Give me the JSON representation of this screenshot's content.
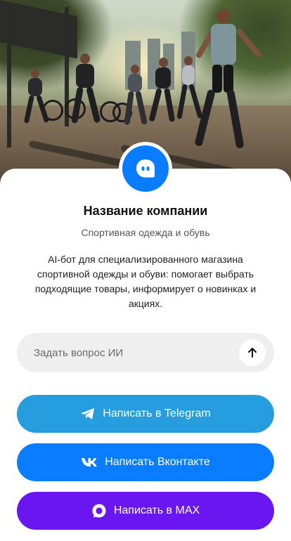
{
  "company": {
    "name": "Название компании",
    "subtitle": "Спортивная одежда и обувь",
    "description": "AI-бот для специализированного магазина спортивной одежды и обуви: помогает выбрать подходящие товары, информирует о новинках и акциях.",
    "logo_icon": "chat-bot-icon",
    "logo_color": "#0a7cff"
  },
  "ask": {
    "placeholder": "Задать вопрос ИИ",
    "value": "",
    "send_icon": "arrow-up-icon"
  },
  "buttons": {
    "telegram": {
      "label": "Написать в Telegram",
      "icon": "telegram-icon",
      "color": "#259ddf"
    },
    "vk": {
      "label": "Написать Вконтакте",
      "icon": "vk-icon",
      "color": "#0a7cff"
    },
    "max": {
      "label": "Написать в MAX",
      "icon": "max-icon",
      "color": "#6a16f0"
    }
  },
  "hero": {
    "image": "runners-at-sunset-photo"
  }
}
